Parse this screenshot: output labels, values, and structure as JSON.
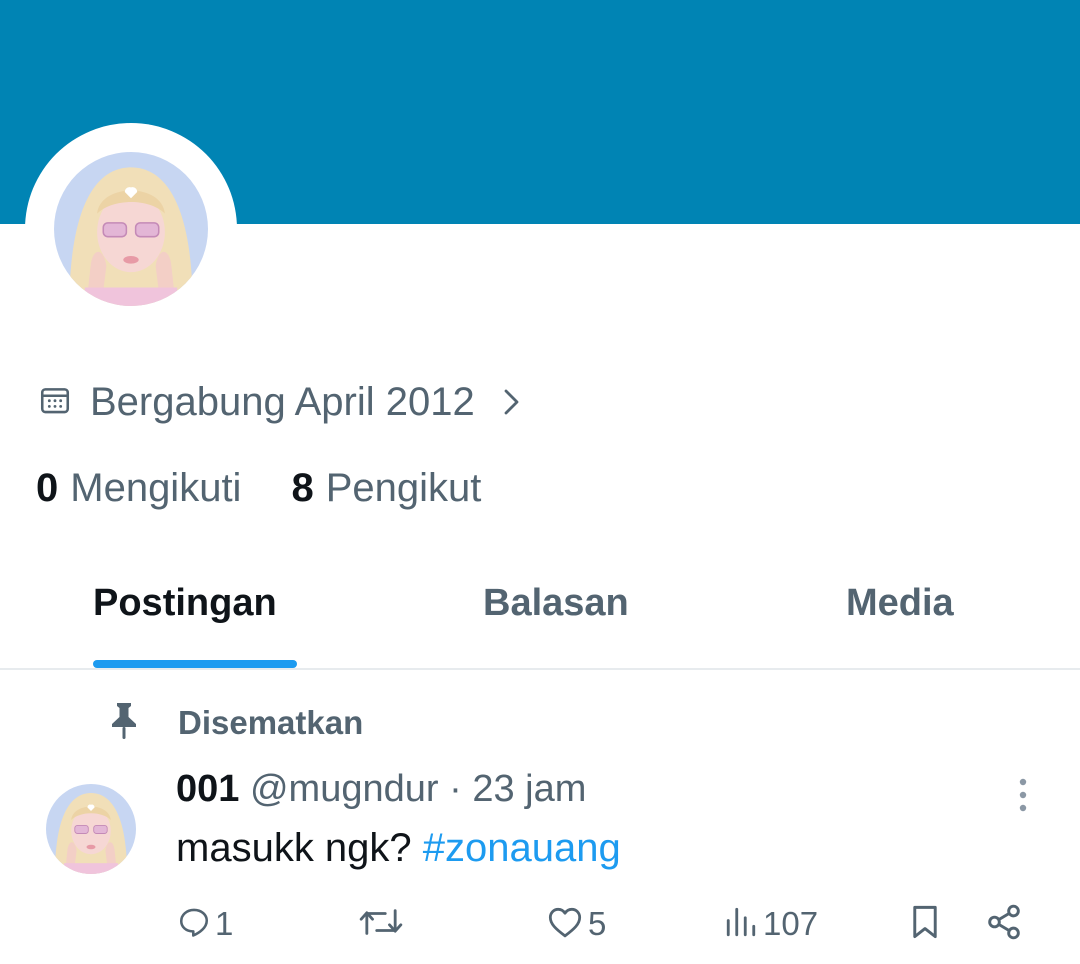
{
  "profile": {
    "joined": "Bergabung April 2012",
    "following_count": "0",
    "following_label": "Mengikuti",
    "followers_count": "8",
    "followers_label": "Pengikut"
  },
  "tabs": [
    {
      "label": "Postingan",
      "active": true
    },
    {
      "label": "Balasan",
      "active": false
    },
    {
      "label": "Media",
      "active": false
    }
  ],
  "post": {
    "pinned_label": "Disematkan",
    "display_name": "001",
    "handle": "@mugndur",
    "separator": "·",
    "time": "23 jam",
    "text": "masukk ngk?",
    "hashtag": "#zonauang",
    "replies": "1",
    "reposts": "",
    "likes": "5",
    "views": "107"
  },
  "icons": {
    "calendar": "calendar-icon",
    "chevron": "chevron-right-icon",
    "pin": "pin-icon",
    "more": "more-vertical-icon",
    "reply": "reply-icon",
    "repost": "repost-icon",
    "like": "heart-icon",
    "views": "views-icon",
    "bookmark": "bookmark-icon",
    "share": "share-icon"
  },
  "colors": {
    "banner": "#0084b4",
    "accent": "#1d9bf0",
    "secondary_text": "#536471",
    "primary_text": "#0f1419"
  }
}
